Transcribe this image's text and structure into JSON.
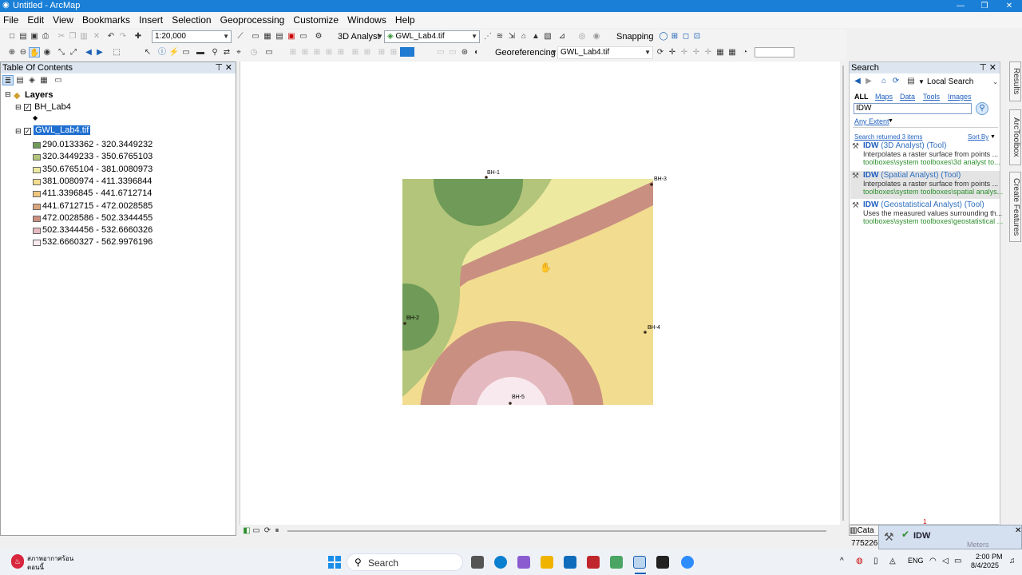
{
  "window": {
    "title": "Untitled - ArcMap"
  },
  "menu": [
    "File",
    "Edit",
    "View",
    "Bookmarks",
    "Insert",
    "Selection",
    "Geoprocessing",
    "Customize",
    "Windows",
    "Help"
  ],
  "toolbar": {
    "scale": "1:20,000",
    "analyst_label": "3D Analyst",
    "layer_combo": "GWL_Lab4.tif",
    "snapping_label": "Snapping",
    "georef_label": "Georeferencing",
    "georef_layer": "GWL_Lab4.tif"
  },
  "toc": {
    "title": "Table Of Contents",
    "layers_label": "Layers",
    "layer1": "BH_Lab4",
    "layer2": "GWL_Lab4.tif",
    "classes": [
      {
        "label": "290.0133362 - 320.3449232",
        "color": "#6f9a57"
      },
      {
        "label": "320.3449233 - 350.6765103",
        "color": "#b3c57a"
      },
      {
        "label": "350.6765104 - 381.0080973",
        "color": "#ede9a0"
      },
      {
        "label": "381.0080974 - 411.3396844",
        "color": "#f2dc90"
      },
      {
        "label": "411.3396845 - 441.6712714",
        "color": "#f0c67e"
      },
      {
        "label": "441.6712715 - 472.0028585",
        "color": "#d9a57a"
      },
      {
        "label": "472.0028586 - 502.3344455",
        "color": "#c98f80"
      },
      {
        "label": "502.3344456 - 532.6660326",
        "color": "#e4b9bf"
      },
      {
        "label": "532.6660327 - 562.9976196",
        "color": "#f8e9ee"
      }
    ]
  },
  "map": {
    "points": [
      {
        "label": "BH-1"
      },
      {
        "label": "BH-2"
      },
      {
        "label": "BH-3"
      },
      {
        "label": "BH-4"
      },
      {
        "label": "BH-5"
      }
    ]
  },
  "search": {
    "title": "Search",
    "scope": "Local Search",
    "tabs": [
      "ALL",
      "Maps",
      "Data",
      "Tools",
      "Images"
    ],
    "query": "IDW",
    "extent": "Any Extent",
    "result_count": "Search returned 3 items",
    "sort": "Sort By",
    "results": [
      {
        "name": "IDW",
        "type": "(3D Analyst) (Tool)",
        "desc": "Interpolates a raster surface from points ...",
        "path": "toolboxes\\system toolboxes\\3d analyst to..."
      },
      {
        "name": "IDW",
        "type": "(Spatial Analyst) (Tool)",
        "desc": "Interpolates a raster surface from points ...",
        "path": "toolboxes\\system toolboxes\\spatial analys..."
      },
      {
        "name": "IDW",
        "type": "(Geostatistical Analyst) (Tool)",
        "desc": "Uses the measured values surrounding th...",
        "path": "toolboxes\\system toolboxes\\geostatistical ..."
      }
    ]
  },
  "sidetabs": [
    "Results",
    "ArcToolbox",
    "Create Features"
  ],
  "notification": {
    "title": "IDW",
    "badge": "1"
  },
  "status": {
    "coords": "775226",
    "catalog_tab": "Cata",
    "units": "Meters"
  },
  "taskbar": {
    "weather": "สภาพอากาศร้อน",
    "weather2": "ตอนนี้",
    "search": "Search",
    "lang": "ENG",
    "time": "2:00 PM",
    "date": "8/4/2025"
  }
}
